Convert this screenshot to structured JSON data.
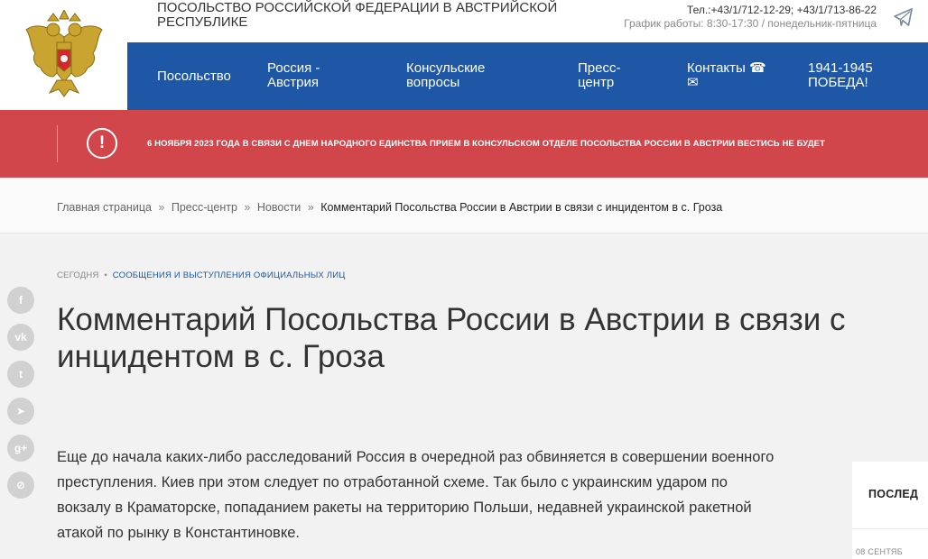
{
  "header": {
    "org_title": "ПОСОЛЬСТВО РОССИЙСКОЙ ФЕДЕРАЦИИ В АВСТРИЙСКОЙ РЕСПУБЛИКЕ",
    "phones": "Тел.:+43/1/712-12-29; +43/1/713-86-22",
    "hours": "График работы: 8:30-17:30 / понедельник-пятница",
    "telegram_icon": "telegram-icon",
    "logo": "coat-of-arms-logo"
  },
  "nav": {
    "items": [
      {
        "label": "Посольство"
      },
      {
        "label": "Россия - Австрия"
      },
      {
        "label": "Консульские вопросы"
      },
      {
        "label": "Пресс-центр"
      },
      {
        "label": "Контакты ☎ ✉"
      },
      {
        "label": "1941-1945 ПОБЕДА!"
      }
    ]
  },
  "alert": {
    "icon": "exclamation-icon",
    "text": "6 НОЯБРЯ 2023 ГОДА В СВЯЗИ С ДНЕМ НАРОДНОГО ЕДИНСТВА ПРИЕМ В КОНСУЛЬСКОМ ОТДЕЛЕ ПОСОЛЬСТВА РОССИИ В АВСТРИИ ВЕСТИСЬ НЕ БУДЕТ"
  },
  "breadcrumb": {
    "items": [
      "Главная страница",
      "Пресс-центр",
      "Новости"
    ],
    "separator": "»",
    "current": "Комментарий Посольства России в Австрии в связи с инцидентом в с. Гроза"
  },
  "article": {
    "date": "СЕГОДНЯ",
    "dot": "•",
    "category": "СООБЩЕНИЯ И ВЫСТУПЛЕНИЯ ОФИЦИАЛЬНЫХ ЛИЦ",
    "title_line1": "Комментарий Посольства России в Австрии в связи с",
    "title_line2": "инцидентом в с. Гроза",
    "body": "Еще до начала каких-либо расследований Россия в очередной раз обвиняется в совершении военного преступления. Киев при этом следует по отработанной схеме. Так было с украинским ударом по вокзалу в Краматорске, попаданием ракеты на территорию Польши, недавней украинской ракетной атакой по рынку в Константиновке."
  },
  "social": {
    "items": [
      {
        "name": "facebook-icon",
        "glyph": "f"
      },
      {
        "name": "vk-icon",
        "glyph": "vk"
      },
      {
        "name": "twitter-icon",
        "glyph": "t"
      },
      {
        "name": "telegram-icon",
        "glyph": "➤"
      },
      {
        "name": "google-plus-icon",
        "glyph": "g+"
      },
      {
        "name": "share-icon",
        "glyph": "⊘"
      }
    ]
  },
  "sidebar": {
    "heading": "ПОСЛЕД",
    "first_date": "08 СЕНТЯБ"
  },
  "colors": {
    "nav_blue": "#1d57a5",
    "alert_red": "#d0464a",
    "social_grey": "#d1d1d1"
  }
}
